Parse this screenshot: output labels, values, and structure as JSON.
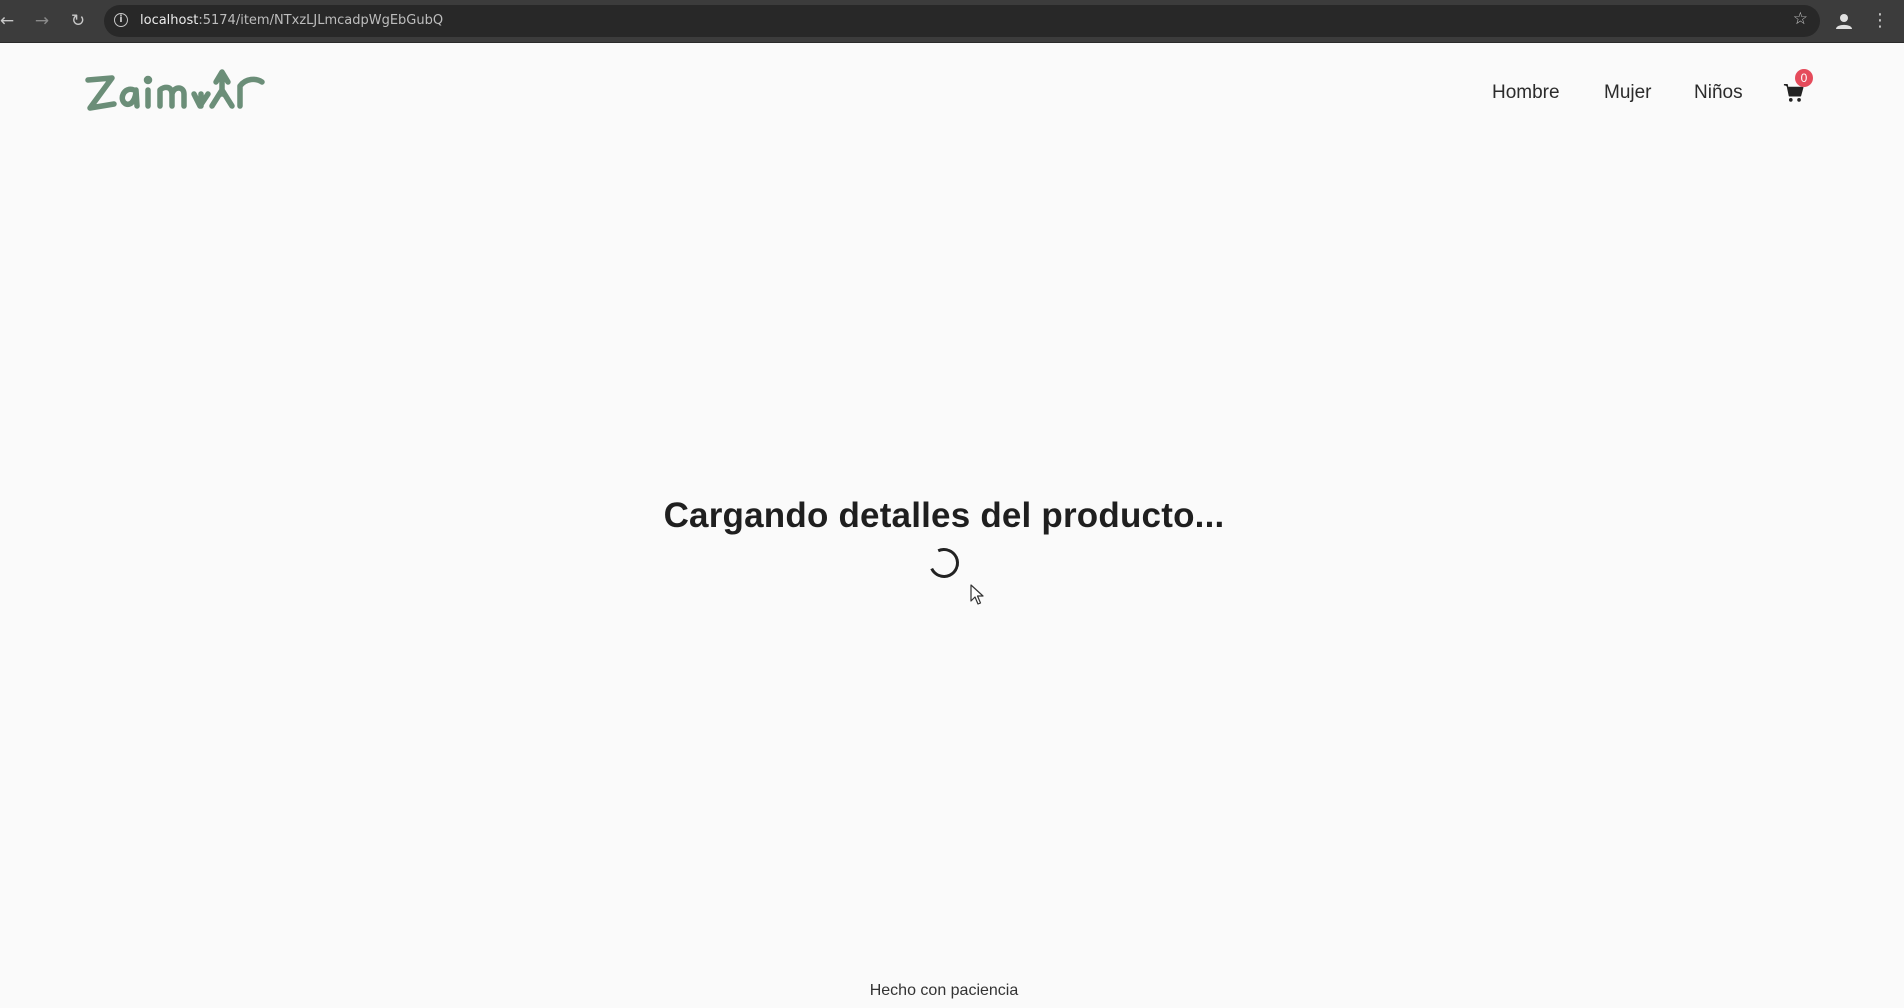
{
  "browser": {
    "url_host": "localhost",
    "url_rest": ":5174/item/NTxzLJLmcadpWgEbGubQ",
    "icons": [
      "back-icon",
      "forward-icon",
      "reload-icon",
      "info-icon",
      "bookmark-star-icon",
      "profile-icon",
      "menu-kebab-icon"
    ]
  },
  "header": {
    "logo_text": "Zaimur",
    "logo_color": "#6b8e78",
    "nav": {
      "hombre": "Hombre",
      "mujer": "Mujer",
      "ninos": "Niños"
    },
    "cart": {
      "icon": "cart-icon",
      "count": "0",
      "badge_color": "#e54b5b"
    }
  },
  "main": {
    "loading_text": "Cargando detalles del producto..."
  },
  "footer": {
    "text": "Hecho con paciencia"
  }
}
